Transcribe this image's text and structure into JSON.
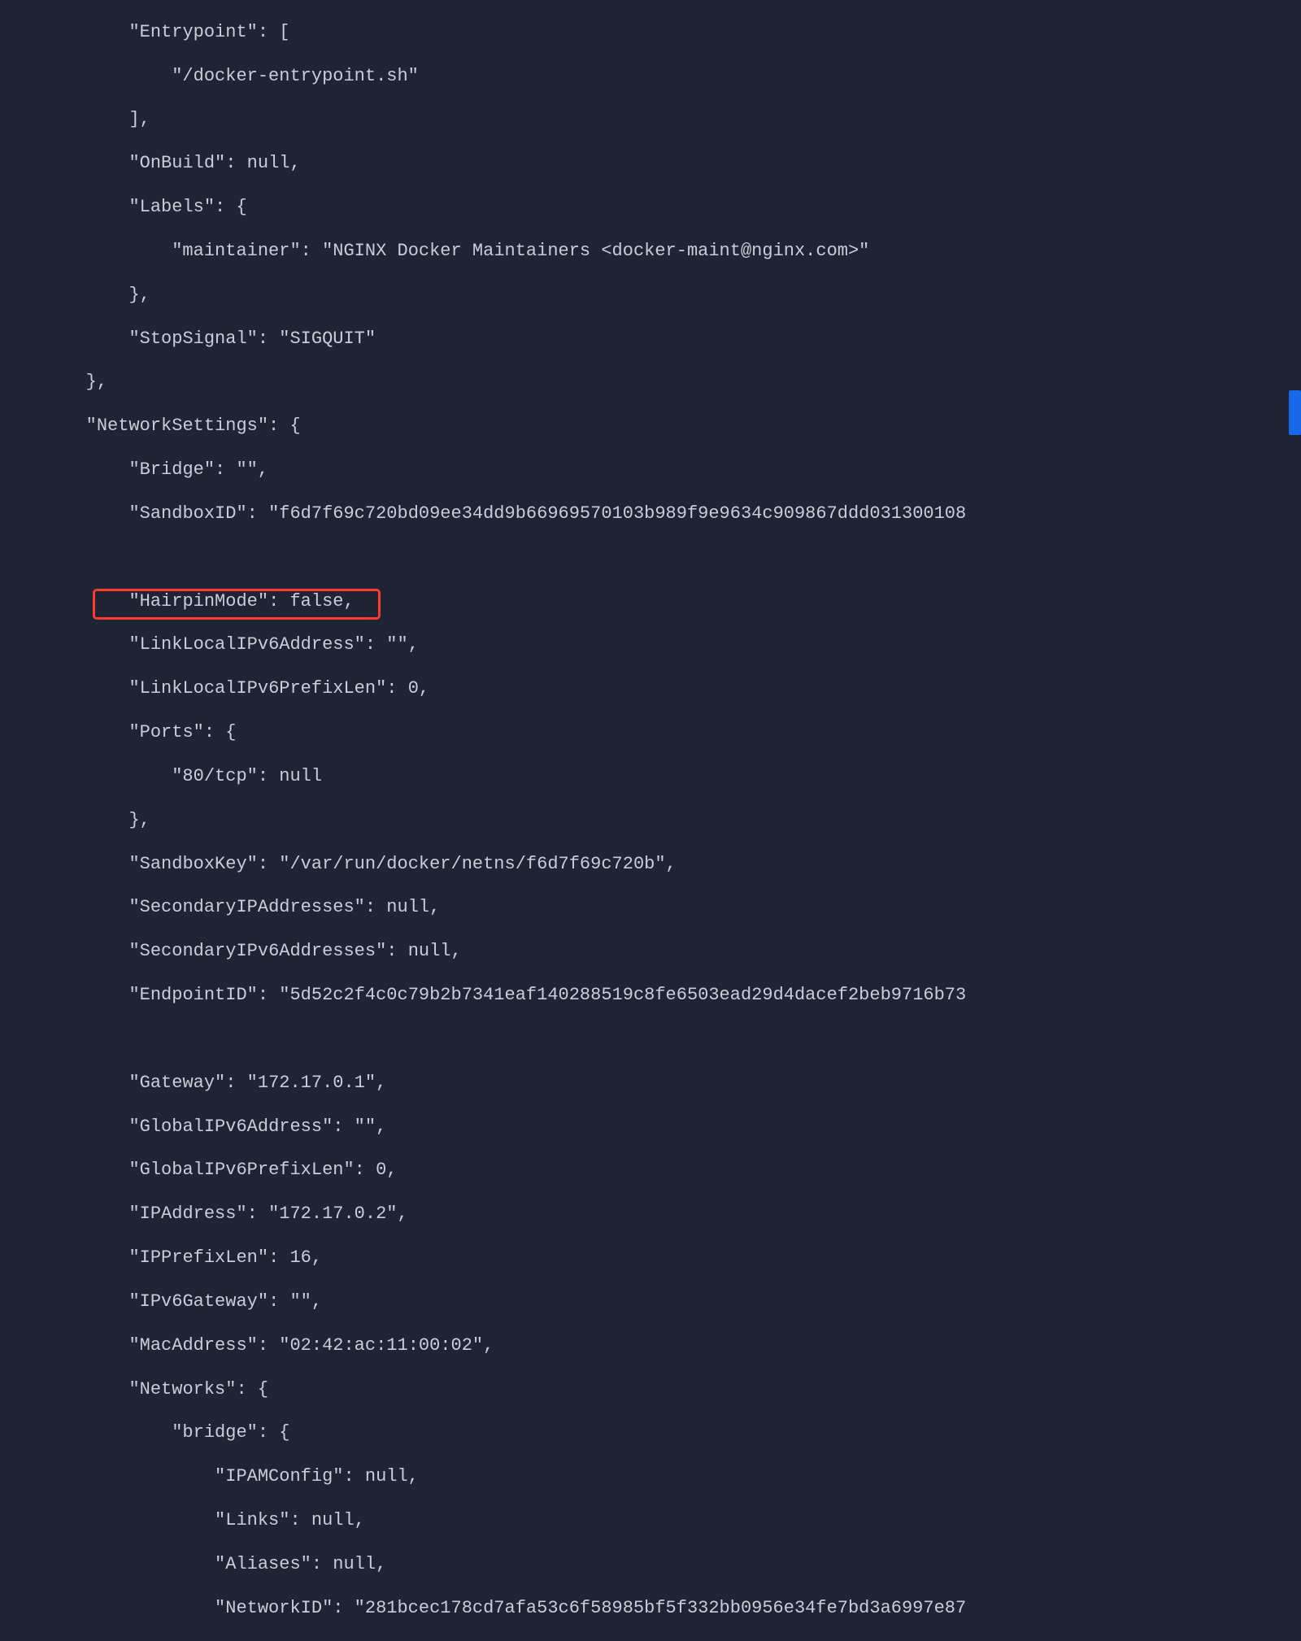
{
  "config": {
    "entrypoint_key": "\"Entrypoint\": [",
    "entrypoint_value": "\"/docker-entrypoint.sh\"",
    "entrypoint_close": "],",
    "onbuild": "\"OnBuild\": null,",
    "labels_key": "\"Labels\": {",
    "maintainer_key": "\"maintainer\": ",
    "maintainer_value": "\"NGINX Docker Maintainers <docker-maint@nginx.com>\"",
    "labels_close": "},",
    "stopsignal": "\"StopSignal\": \"SIGQUIT\"",
    "config_close": "},"
  },
  "network": {
    "networksettings_key": "\"NetworkSettings\": {",
    "bridge": "\"Bridge\": \"\",",
    "sandboxid": "\"SandboxID\": \"f6d7f69c720bd09ee34dd9b66969570103b989f9e9634c909867ddd031300108",
    "hairpinmode": "\"HairpinMode\": false,",
    "linklocalipv6address": "\"LinkLocalIPv6Address\": \"\",",
    "linklocalipv6prefixlen": "\"LinkLocalIPv6PrefixLen\": 0,",
    "ports_key": "\"Ports\": {",
    "port_80": "\"80/tcp\": null",
    "ports_close": "},",
    "sandboxkey": "\"SandboxKey\": \"/var/run/docker/netns/f6d7f69c720b\",",
    "secondaryipaddresses": "\"SecondaryIPAddresses\": null,",
    "secondaryipv6addresses": "\"SecondaryIPv6Addresses\": null,",
    "endpointid": "\"EndpointID\": \"5d52c2f4c0c79b2b7341eaf140288519c8fe6503ead29d4dacef2beb9716b73",
    "gateway": "\"Gateway\": \"172.17.0.1\",",
    "globalipv6address": "\"GlobalIPv6Address\": \"\",",
    "globalipv6prefixlen": "\"GlobalIPv6PrefixLen\": 0,",
    "ipaddress": "\"IPAddress\": \"172.17.0.2\",",
    "ipprefixlen": "\"IPPrefixLen\": 16,",
    "ipv6gateway": "\"IPv6Gateway\": \"\",",
    "macaddress": "\"MacAddress\": \"02:42:ac:11:00:02\",",
    "networks_key": "\"Networks\": {",
    "bridge_key": "\"bridge\": {",
    "ipamconfig": "\"IPAMConfig\": null,",
    "links": "\"Links\": null,",
    "aliases": "\"Aliases\": null,",
    "networkid": "\"NetworkID\": \"281bcec178cd7afa53c6f58985bf5f332bb0956e34fe7bd3a6997e87"
  }
}
